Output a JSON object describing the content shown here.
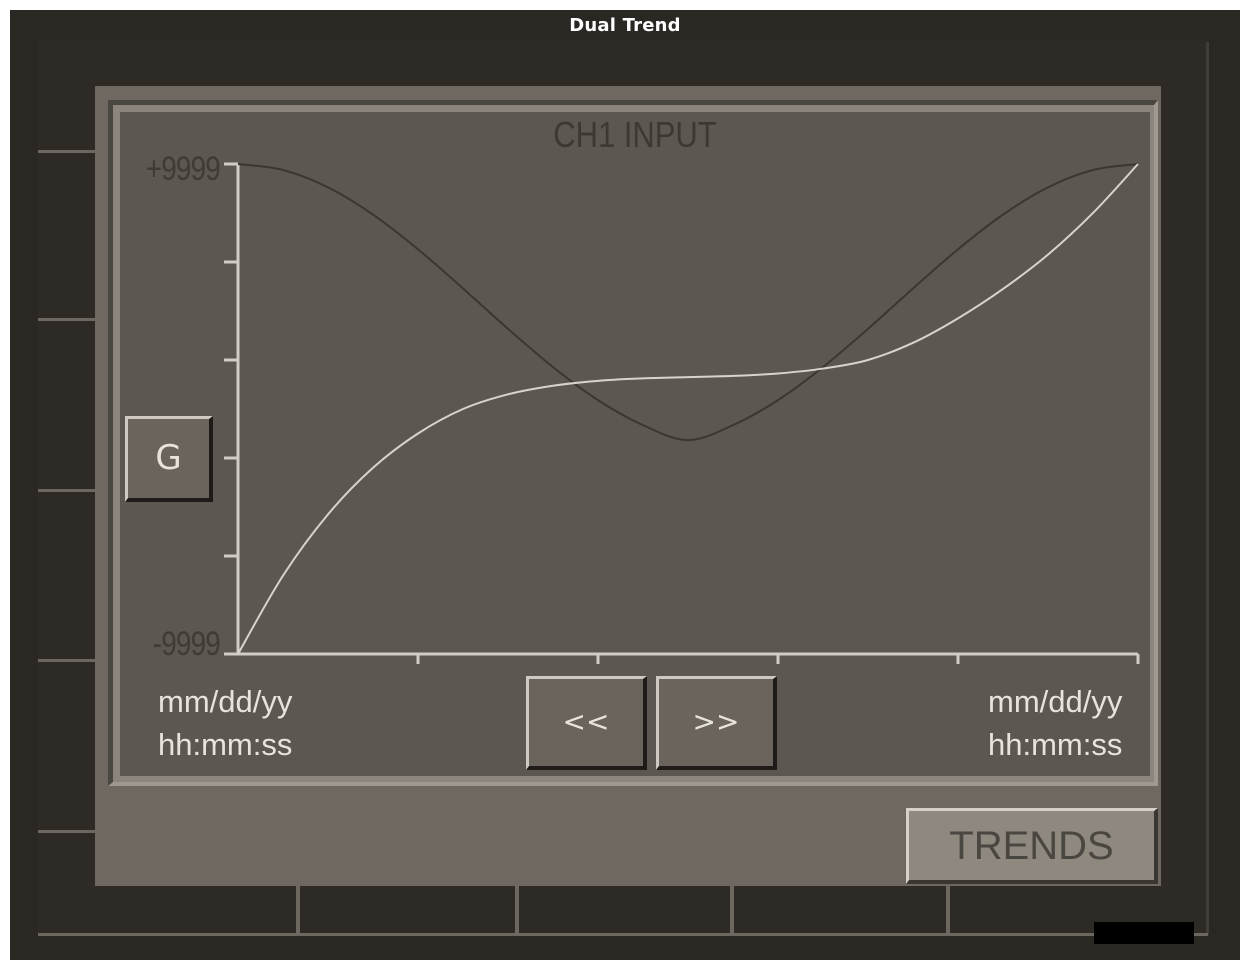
{
  "window": {
    "title": "Dual Trend"
  },
  "chart": {
    "title": "CH1 INPUT",
    "y_max_label": "+9999",
    "y_min_label": "-9999",
    "left_date": "mm/dd/yy",
    "left_time": "hh:mm:ss",
    "right_date": "mm/dd/yy",
    "right_time": "hh:mm:ss"
  },
  "buttons": {
    "g_label": "G",
    "prev_label": "<<",
    "next_label": ">>",
    "trends_label": "TRENDS"
  },
  "chart_data": {
    "type": "line",
    "title": "CH1 INPUT",
    "ylim": [
      -9999,
      9999
    ],
    "yticks": [
      "+9999",
      "-9999"
    ],
    "xticks": [
      "mm/dd/yy hh:mm:ss",
      "mm/dd/yy hh:mm:ss"
    ],
    "grid": false,
    "series": [
      {
        "color": "#3a3732",
        "x": [
          0,
          0.05,
          0.1,
          0.15,
          0.2,
          0.25,
          0.3,
          0.35,
          0.4,
          0.45,
          0.5,
          0.55,
          0.6,
          0.65,
          0.7,
          0.75,
          0.8,
          0.85,
          0.9,
          0.95,
          1.0
        ],
        "values": [
          9999,
          9755,
          9045,
          7933,
          6518,
          4920,
          3272,
          1710,
          362,
          -659,
          -1268,
          -659,
          362,
          1710,
          3272,
          4920,
          6518,
          7933,
          9045,
          9755,
          9999
        ]
      },
      {
        "color": "#d8d4cc",
        "x": [
          0,
          0.05,
          0.1,
          0.15,
          0.2,
          0.25,
          0.3,
          0.35,
          0.4,
          0.45,
          0.5,
          0.55,
          0.6,
          0.65,
          0.7,
          0.75,
          0.8,
          0.85,
          0.9,
          0.95,
          1.0
        ],
        "values": [
          -9999,
          -6800,
          -4300,
          -2400,
          -1000,
          0,
          600,
          950,
          1150,
          1250,
          1300,
          1350,
          1450,
          1650,
          2000,
          2700,
          3700,
          4900,
          6300,
          8000,
          9999
        ]
      }
    ]
  }
}
